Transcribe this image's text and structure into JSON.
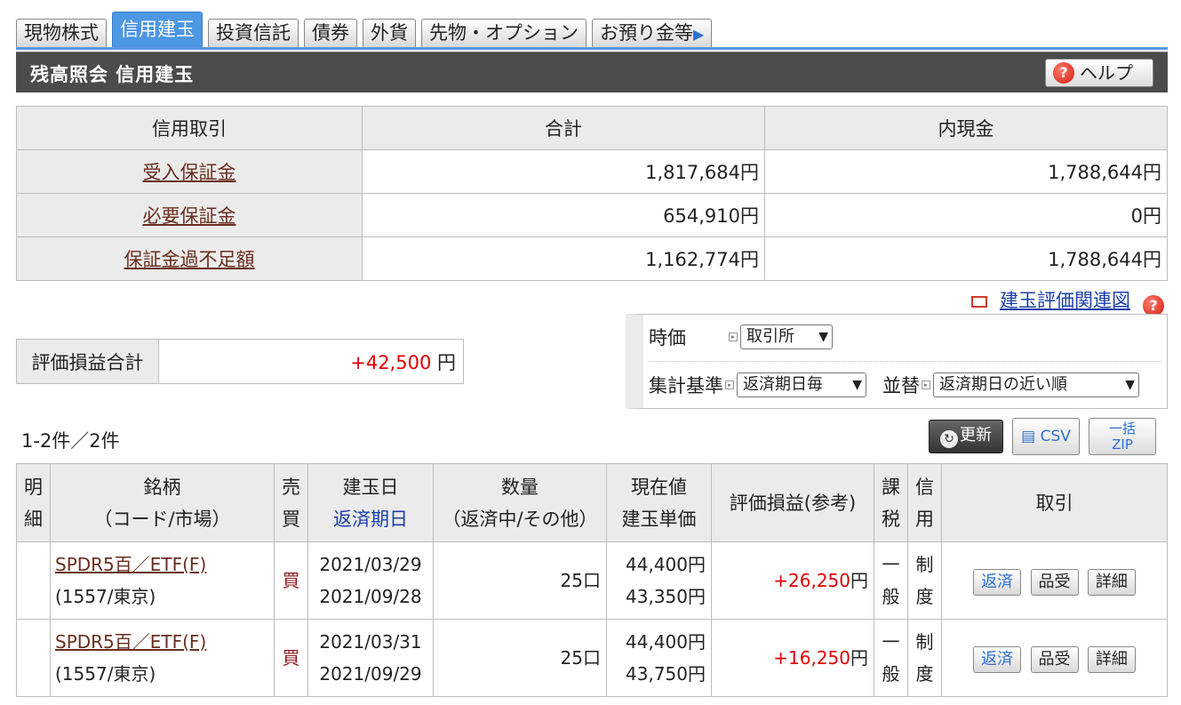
{
  "tabs": [
    {
      "label": "現物株式",
      "active": false
    },
    {
      "label": "信用建玉",
      "active": true
    },
    {
      "label": "投資信託",
      "active": false
    },
    {
      "label": "債券",
      "active": false
    },
    {
      "label": "外貨",
      "active": false
    },
    {
      "label": "先物・オプション",
      "active": false
    },
    {
      "label": "お預り金等",
      "active": false
    }
  ],
  "header": {
    "title": "残高照会 信用建玉",
    "help_label": "ヘルプ"
  },
  "margin_table": {
    "headers": [
      "信用取引",
      "合計",
      "内現金"
    ],
    "rows": [
      {
        "label": "受入保証金",
        "total": "1,817,684円",
        "cash": "1,788,644円"
      },
      {
        "label": "必要保証金",
        "total": "654,910円",
        "cash": "0円"
      },
      {
        "label": "保証金過不足額",
        "total": "1,162,774円",
        "cash": "1,788,644円"
      }
    ]
  },
  "related_link": "建玉評価関連図",
  "eval_total": {
    "label": "評価損益合計",
    "value": "+42,500",
    "unit": "円"
  },
  "options": {
    "price_label": "時価",
    "price_select": "取引所",
    "agg_label": "集計基準",
    "agg_select": "返済期日毎",
    "sort_label": "並替",
    "sort_select": "返済期日の近い順"
  },
  "count_text": "1-2件／2件",
  "buttons": {
    "refresh": "更新",
    "csv": "CSV",
    "zip_top": "一括",
    "zip_bottom": "ZIP"
  },
  "positions": {
    "headers": {
      "detail": [
        "明",
        "細"
      ],
      "name": [
        "銘柄",
        "（コード/市場）"
      ],
      "side": [
        "売",
        "買"
      ],
      "date": [
        "建玉日",
        "返済期日"
      ],
      "qty": [
        "数量",
        "（返済中/その他）"
      ],
      "price": [
        "現在値",
        "建玉単価"
      ],
      "pl": "評価損益(参考)",
      "tax": [
        "課",
        "税"
      ],
      "credit": [
        "信",
        "用"
      ],
      "trade": "取引"
    },
    "rows": [
      {
        "name": "SPDR5百／ETF(F)",
        "code": "(1557/東京)",
        "side": "買",
        "open_date": "2021/03/29",
        "due_date": "2021/09/28",
        "qty": "25口",
        "current": "44,400円",
        "open_price": "43,350円",
        "pl": "+26,250",
        "pl_unit": "円",
        "tax": [
          "一",
          "般"
        ],
        "credit": [
          "制",
          "度"
        ],
        "actions": [
          "返済",
          "品受",
          "詳細"
        ]
      },
      {
        "name": "SPDR5百／ETF(F)",
        "code": "(1557/東京)",
        "side": "買",
        "open_date": "2021/03/31",
        "due_date": "2021/09/29",
        "qty": "25口",
        "current": "44,400円",
        "open_price": "43,750円",
        "pl": "+16,250",
        "pl_unit": "円",
        "tax": [
          "一",
          "般"
        ],
        "credit": [
          "制",
          "度"
        ],
        "actions": [
          "返済",
          "品受",
          "詳細"
        ]
      }
    ]
  }
}
